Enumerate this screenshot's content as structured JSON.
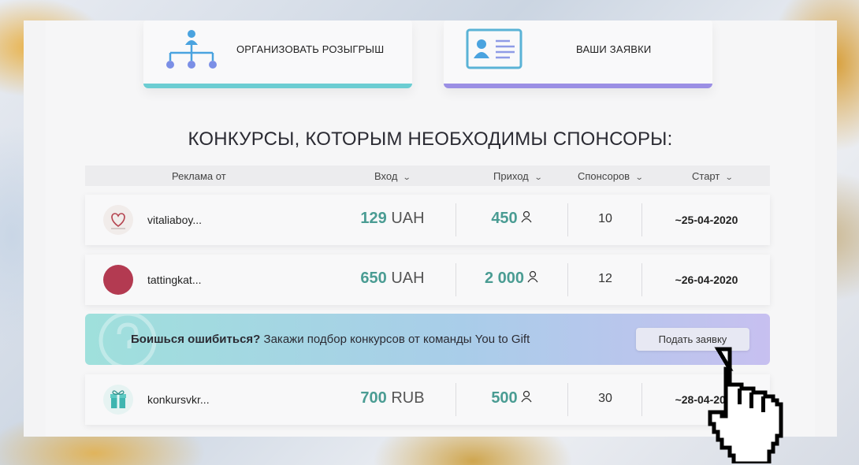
{
  "cards": [
    {
      "label": "ОРГАНИЗОВАТЬ РОЗЫГРЫШ",
      "icon": "org-chart-icon"
    },
    {
      "label": "ВАШИ ЗАЯВКИ",
      "icon": "id-card-icon"
    }
  ],
  "heading": "КОНКУРСЫ, КОТОРЫМ НЕОБХОДИМЫ СПОНСОРЫ:",
  "table": {
    "columns": [
      "Реклама от",
      "Вход",
      "Приход",
      "Спонсоров",
      "Старт"
    ],
    "rows": [
      {
        "name": "vitaliaboy...",
        "entry_amount": "129",
        "entry_currency": "UAH",
        "income": "450",
        "sponsors": "10",
        "start": "~25-04-2020"
      },
      {
        "name": "tattingkat...",
        "entry_amount": "650",
        "entry_currency": "UAH",
        "income": "2 000",
        "sponsors": "12",
        "start": "~26-04-2020"
      },
      {
        "name": "konkursvkr...",
        "entry_amount": "700",
        "entry_currency": "RUB",
        "income": "500",
        "sponsors": "30",
        "start": "~28-04-2020"
      }
    ]
  },
  "banner": {
    "bold": "Боишься ошибиться?",
    "text": " Закажи подбор конкурсов от команды You to Gift",
    "button": "Подать заявку"
  },
  "colors": {
    "accent_teal": "#4a9c93",
    "card1_bar": "#6ccdd2",
    "card2_bar": "#9b8fe4"
  }
}
